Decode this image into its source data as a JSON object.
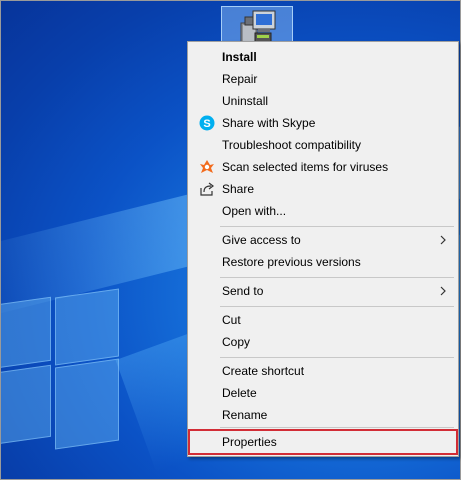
{
  "desktop": {
    "selected_icon": "setup-installer-icon"
  },
  "context_menu": {
    "items": [
      {
        "label": "Install",
        "bold": true
      },
      {
        "label": "Repair"
      },
      {
        "label": "Uninstall"
      },
      {
        "label": "Share with Skype",
        "icon": "skype-icon"
      },
      {
        "label": "Troubleshoot compatibility"
      },
      {
        "label": "Scan selected items for viruses",
        "icon": "avast-icon"
      },
      {
        "label": "Share",
        "icon": "share-icon"
      },
      {
        "label": "Open with..."
      },
      {
        "label": "Give access to",
        "submenu": true
      },
      {
        "label": "Restore previous versions"
      },
      {
        "label": "Send to",
        "submenu": true
      },
      {
        "label": "Cut"
      },
      {
        "label": "Copy"
      },
      {
        "label": "Create shortcut"
      },
      {
        "label": "Delete"
      },
      {
        "label": "Rename"
      },
      {
        "label": "Properties",
        "highlighted": true
      }
    ]
  },
  "colors": {
    "menu_background": "#f0f0f0",
    "highlight_border": "#d22d36",
    "skype_blue": "#00aff0",
    "avast_orange": "#f26b1d",
    "desktop_blue": "#0b52c6"
  }
}
